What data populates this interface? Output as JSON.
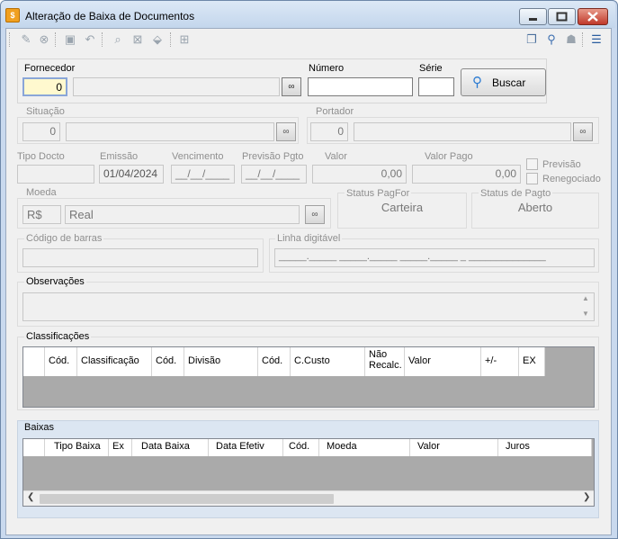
{
  "window": {
    "title": "Alteração de Baixa de Documentos",
    "icon": "document-icon"
  },
  "titlebar_buttons": [
    "minimize-icon",
    "maximize-icon",
    "close-icon"
  ],
  "toolbar": {
    "left_icons": [
      "edit-icon",
      "cancel-icon",
      "save-icon",
      "undo-icon",
      "search-icon",
      "filter-icon",
      "stamp-icon",
      "print-icon"
    ],
    "right_icons": [
      "window-list-icon",
      "key-icon",
      "user-icon",
      "menu-icon"
    ]
  },
  "fornecedor": {
    "label": "Fornecedor",
    "code": "0",
    "name": ""
  },
  "numero": {
    "label": "Número",
    "value": ""
  },
  "serie": {
    "label": "Série",
    "value": ""
  },
  "buscar": {
    "label": "Buscar"
  },
  "situacao": {
    "label": "Situação",
    "code": "0",
    "name": ""
  },
  "portador": {
    "label": "Portador",
    "code": "0",
    "name": ""
  },
  "tipo_docto": {
    "label": "Tipo Docto",
    "value": ""
  },
  "emissao": {
    "label": "Emissão",
    "value": "01/04/2024"
  },
  "vencimento": {
    "label": "Vencimento",
    "value": "__/__/____"
  },
  "previsao_pgto": {
    "label": "Previsão Pgto",
    "value": "__/__/____"
  },
  "valor": {
    "label": "Valor",
    "value": "0,00"
  },
  "valor_pago": {
    "label": "Valor Pago",
    "value": "0,00"
  },
  "previsao_check": {
    "label": "Previsão",
    "checked": false
  },
  "renegociado_check": {
    "label": "Renegociado",
    "checked": false
  },
  "moeda": {
    "label": "Moeda",
    "code": "R$",
    "name": "Real"
  },
  "status_pagfor": {
    "label": "Status PagFor",
    "value": "Carteira"
  },
  "status_pagto": {
    "label": "Status de Pagto",
    "value": "Aberto"
  },
  "codigo_barras": {
    "label": "Código de barras",
    "value": ""
  },
  "linha_digitavel": {
    "label": "Linha digitável",
    "value": "_____._____ _____._____ _____._____ _ ______________"
  },
  "observacoes": {
    "label": "Observações",
    "value": ""
  },
  "classificacoes": {
    "label": "Classificações",
    "columns": [
      "Cód.",
      "Classificação",
      "Cód.",
      "Divisão",
      "Cód.",
      "C.Custo",
      "Não Recalc.",
      "Valor",
      "+/-",
      "EX"
    ]
  },
  "baixas": {
    "label": "Baixas",
    "columns": [
      "Tipo Baixa",
      "Ex",
      "Data Baixa",
      "Data Efetiv",
      "Cód.",
      "Moeda",
      "Valor",
      "Juros"
    ]
  }
}
